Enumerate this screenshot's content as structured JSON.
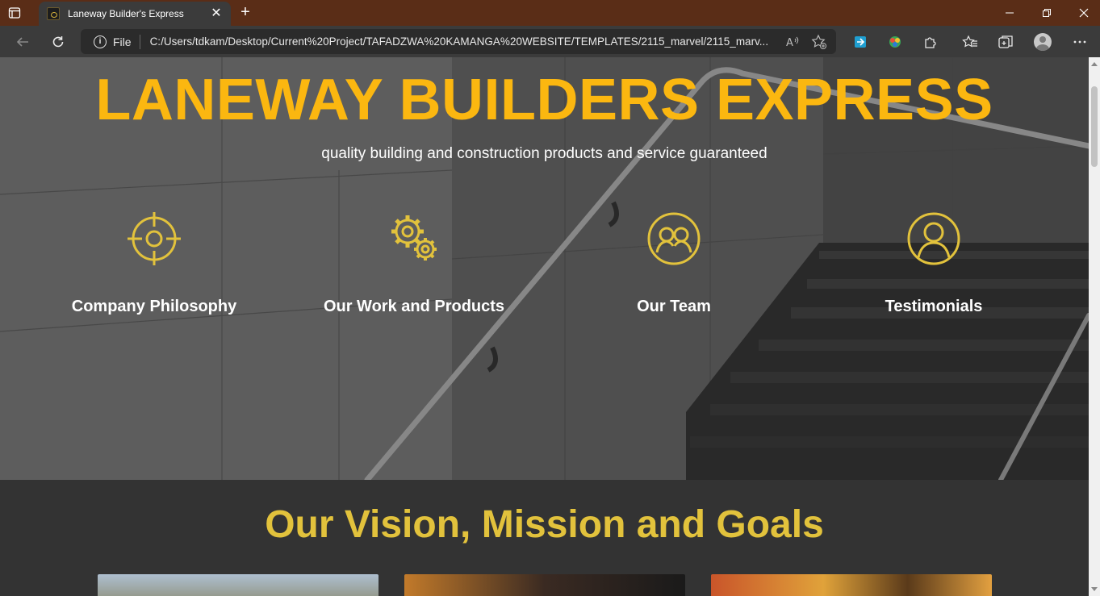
{
  "browser": {
    "tab_title": "Laneway Builder's Express",
    "scheme_label": "File",
    "url": "C:/Users/tdkam/Desktop/Current%20Project/TAFADZWA%20KAMANGA%20WEBSITE/TEMPLATES/2115_marvel/2115_marv...",
    "accent_color": "#5a2d17"
  },
  "hero": {
    "title": "LANEWAY BUILDERS EXPRESS",
    "subtitle": "quality building and construction products and service guaranteed",
    "title_color": "#fbb710",
    "features": [
      {
        "label": "Company Philosophy",
        "icon": "target-icon"
      },
      {
        "label": "Our Work and Products",
        "icon": "gears-icon"
      },
      {
        "label": "Our Team",
        "icon": "team-icon"
      },
      {
        "label": "Testimonials",
        "icon": "user-icon"
      }
    ]
  },
  "vision": {
    "title": "Our Vision, Mission and Goals",
    "title_color": "#e2c23c"
  }
}
